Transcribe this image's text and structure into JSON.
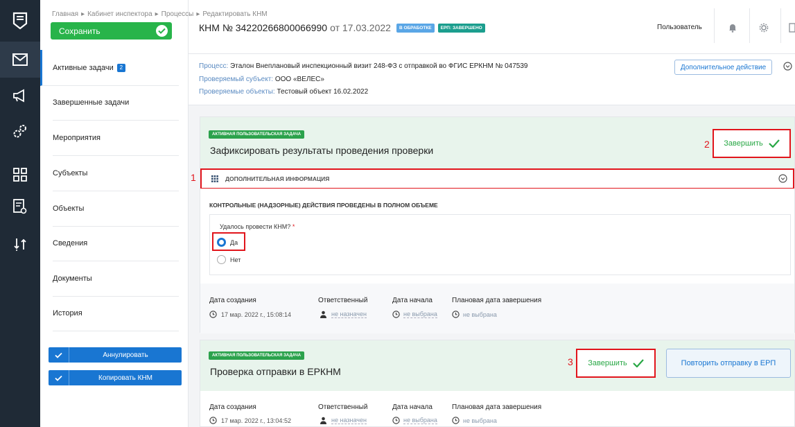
{
  "rail": {
    "items": [
      "logo-icon",
      "mail-icon",
      "megaphone-icon",
      "gears-icon",
      "grid-icon",
      "report-icon",
      "sort-icon"
    ]
  },
  "save_label": "Сохранить",
  "breadcrumb": [
    "Главная",
    "▸",
    "Кабинет инспектора",
    "▸",
    "Процессы",
    "▸",
    "Редактировать КНМ"
  ],
  "header": {
    "title": "КНМ № 34220266800066990",
    "date": "от 17.03.2022",
    "tag1": "В ОБРАБОТКЕ",
    "tag1_color": "#5aa6e6",
    "tag2": "ЕРП: ЗАВЕРШЕНО",
    "tag2_color": "#1b9e8e",
    "user": "Пользователь"
  },
  "sidebar": {
    "items": [
      {
        "label": "Активные задачи",
        "badge": "2"
      },
      {
        "label": "Завершенные задачи"
      },
      {
        "label": "Мероприятия"
      },
      {
        "label": "Субъекты"
      },
      {
        "label": "Объекты"
      },
      {
        "label": "Сведения"
      },
      {
        "label": "Документы"
      },
      {
        "label": "История"
      }
    ],
    "annul_label": "Аннулировать",
    "copy_label": "Копировать КНМ"
  },
  "info": {
    "process_key": "Процесс:",
    "process_val": "Эталон Внеплановый инспекционный визит 248-ФЗ с отправкой во ФГИС ЕРКНМ № 047539",
    "subject_key": "Проверяемый субъект:",
    "subject_val": "ООО «ВЕЛЕС»",
    "objects_key": "Проверяемые объекты:",
    "objects_val": "Тестовый объект 16.02.2022",
    "extra_action": "Дополнительное действие"
  },
  "task1": {
    "tag": "АКТИВНАЯ ПОЛЬЗОВАТЕЛЬСКАЯ ЗАДАЧА",
    "title": "Зафиксировать результаты проведения проверки",
    "finish": "Завершить",
    "additional": "ДОПОЛНИТЕЛЬНАЯ ИНФОРМАЦИЯ",
    "section": "КОНТРОЛЬНЫЕ (НАДЗОРНЫЕ) ДЕЙСТВИЯ ПРОВЕДЕНЫ В ПОЛНОМ ОБЪЕМЕ",
    "question": "Удалось провести КНМ?",
    "required": "*",
    "opt_yes": "Да",
    "opt_no": "Нет",
    "selected": "Да",
    "created_h": "Дата создания",
    "created_v": "17 мар. 2022 г., 15:08:14",
    "resp_h": "Ответственный",
    "resp_v": "не назначен",
    "start_h": "Дата начала",
    "start_v": "не выбрана",
    "plan_h": "Плановая дата завершения",
    "plan_v": "не выбрана"
  },
  "task2": {
    "tag": "АКТИВНАЯ ПОЛЬЗОВАТЕЛЬСКАЯ ЗАДАЧА",
    "title": "Проверка отправки в ЕРКНМ",
    "finish": "Завершить",
    "retry": "Повторить отправку в ЕРП",
    "created_h": "Дата создания",
    "created_v": "17 мар. 2022 г., 13:04:52",
    "resp_h": "Ответственный",
    "resp_v": "не назначен",
    "start_h": "Дата начала",
    "start_v": "не выбрана",
    "plan_h": "Плановая дата завершения",
    "plan_v": "не выбрана"
  },
  "annotations": {
    "n1": "1",
    "n2": "2",
    "n3": "3"
  },
  "colors": {
    "accent": "#1976d2",
    "success": "#28b44a",
    "highlight": "#e1141b",
    "rail": "#1f2a36"
  }
}
